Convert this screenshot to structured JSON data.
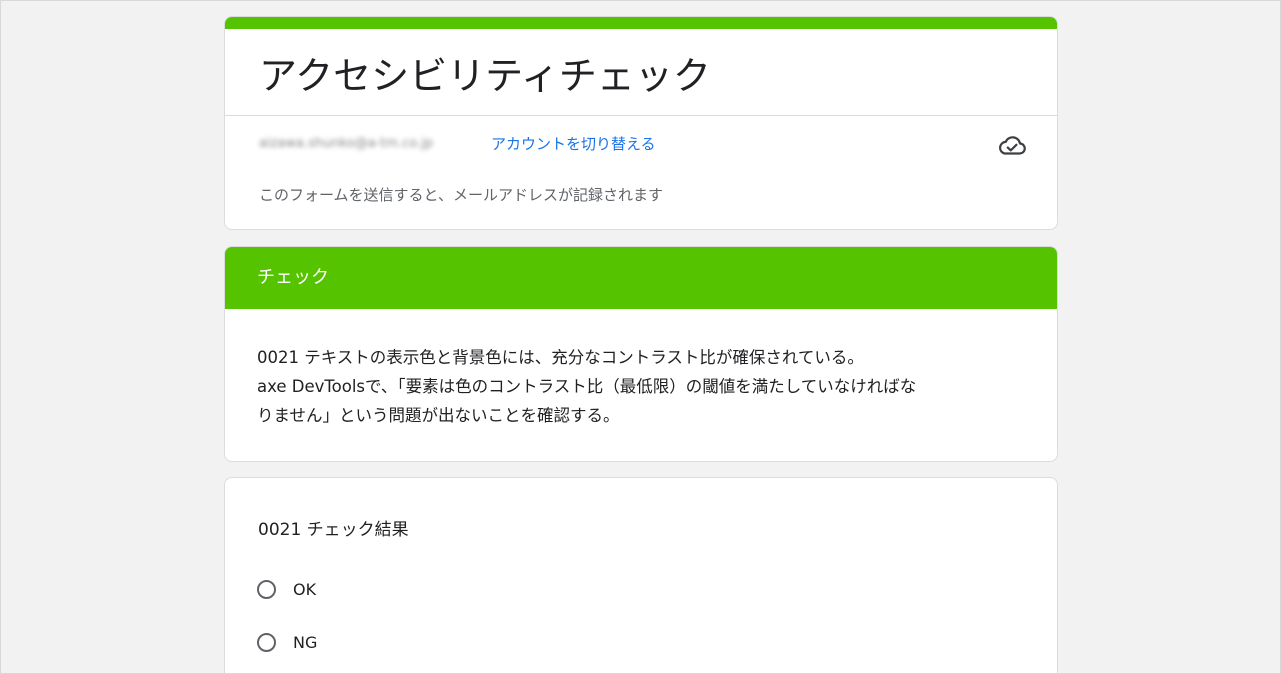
{
  "form": {
    "title": "アクセシビリティチェック",
    "email": "aizawa.shunko@a-tm.co.jp",
    "switch_account": "アカウントを切り替える",
    "save_status_icon": "cloud-check-icon",
    "notice": "このフォームを送信すると、メールアドレスが記録されます",
    "accent_color": "#56c300"
  },
  "section": {
    "title": "チェック",
    "description_lines": [
      "0021 テキストの表示色と背景色には、充分なコントラスト比が確保されている。",
      "axe DevToolsで、「要素は色のコントラスト比（最低限）の閾値を満たしていなければな",
      "りません」という問題が出ないことを確認する。"
    ]
  },
  "question": {
    "title": "0021 チェック結果",
    "options": [
      {
        "label": "OK"
      },
      {
        "label": "NG"
      }
    ]
  }
}
